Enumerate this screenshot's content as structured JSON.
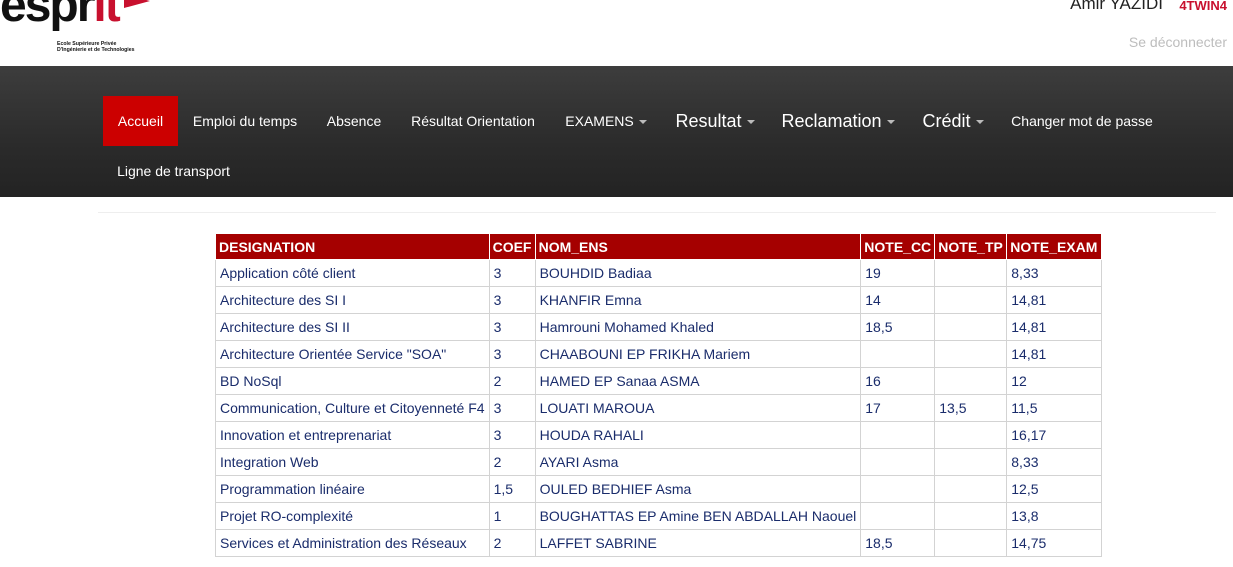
{
  "header": {
    "logo_text": "esprit",
    "logo_subtitle": "Ecole Supérieure Privée\nD'Ingénierie et de Technologies",
    "user_name": "Amir YAZIDI",
    "user_class": "4TWIN4",
    "logout_label": "Se déconnecter"
  },
  "nav": {
    "items": [
      {
        "label": "Accueil"
      },
      {
        "label": "Emploi du temps"
      },
      {
        "label": "Absence"
      },
      {
        "label": "Résultat Orientation"
      },
      {
        "label": "EXAMENS"
      },
      {
        "label": "Resultat"
      },
      {
        "label": "Reclamation"
      },
      {
        "label": "Crédit"
      },
      {
        "label": "Changer mot de passe"
      },
      {
        "label": "Ligne de transport"
      }
    ],
    "active": "Accueil"
  },
  "table": {
    "headers": [
      "DESIGNATION",
      "COEF",
      "NOM_ENS",
      "NOTE_CC",
      "NOTE_TP",
      "NOTE_EXAM"
    ],
    "rows": [
      [
        "Application côté client",
        "3",
        "BOUHDID Badiaa",
        "19",
        "",
        "8,33"
      ],
      [
        "Architecture des SI I",
        "3",
        "KHANFIR Emna",
        "14",
        "",
        "14,81"
      ],
      [
        "Architecture des SI II",
        "3",
        "Hamrouni Mohamed Khaled",
        "18,5",
        "",
        "14,81"
      ],
      [
        "Architecture Orientée Service \"SOA\"",
        "3",
        "CHAABOUNI EP FRIKHA Mariem",
        "",
        "",
        "14,81"
      ],
      [
        "BD NoSql",
        "2",
        "HAMED EP Sanaa ASMA",
        "16",
        "",
        "12"
      ],
      [
        "Communication, Culture et Citoyenneté F4",
        "3",
        "LOUATI MAROUA",
        "17",
        "13,5",
        "11,5"
      ],
      [
        "Innovation et entreprenariat",
        "3",
        "HOUDA RAHALI",
        "",
        "",
        "16,17"
      ],
      [
        "Integration Web",
        "2",
        "AYARI Asma",
        "",
        "",
        "8,33"
      ],
      [
        "Programmation linéaire",
        "1,5",
        "OULED BEDHIEF Asma",
        "",
        "",
        "12,5"
      ],
      [
        "Projet RO-complexité",
        "1",
        "BOUGHATTAS EP Amine BEN ABDALLAH Naouel",
        "",
        "",
        "13,8"
      ],
      [
        "Services et Administration des Réseaux",
        "2",
        "LAFFET SABRINE",
        "18,5",
        "",
        "14,75"
      ]
    ]
  },
  "colors": {
    "nav_active": "#cc0000",
    "table_header": "#a50000",
    "table_text": "#1a2c6b",
    "brand_red": "#c8102e"
  }
}
